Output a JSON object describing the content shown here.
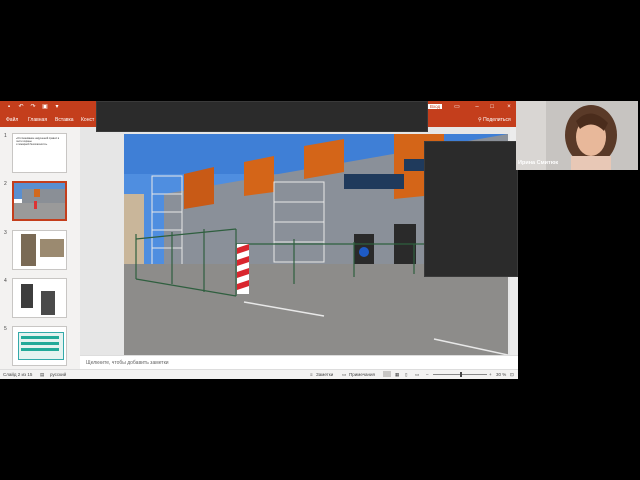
{
  "ppt": {
    "tabs": [
      "Файл",
      "Главная",
      "Вставка",
      "Конст"
    ],
    "login_label": "Вход",
    "share_label": "Поделиться",
    "notes_placeholder": "Щелкните, чтобы добавить заметки",
    "status": {
      "slide_counter": "Слайд 2 из 15",
      "language": "русский",
      "notes_button": "Заметки",
      "comments_button": "Примечания",
      "zoom": "30 %"
    },
    "thumbnails": [
      {
        "num": "1",
        "lines": [
          "«Отслеживание нарушений правил в части охраны",
          "и пожарной безопасности»"
        ]
      },
      {
        "num": "2"
      },
      {
        "num": "3"
      },
      {
        "num": "4"
      },
      {
        "num": "5"
      }
    ]
  },
  "webcam": {
    "name": "Ирина Смитюк"
  },
  "colors": {
    "accent": "#c43e1c",
    "background": "#000000"
  }
}
